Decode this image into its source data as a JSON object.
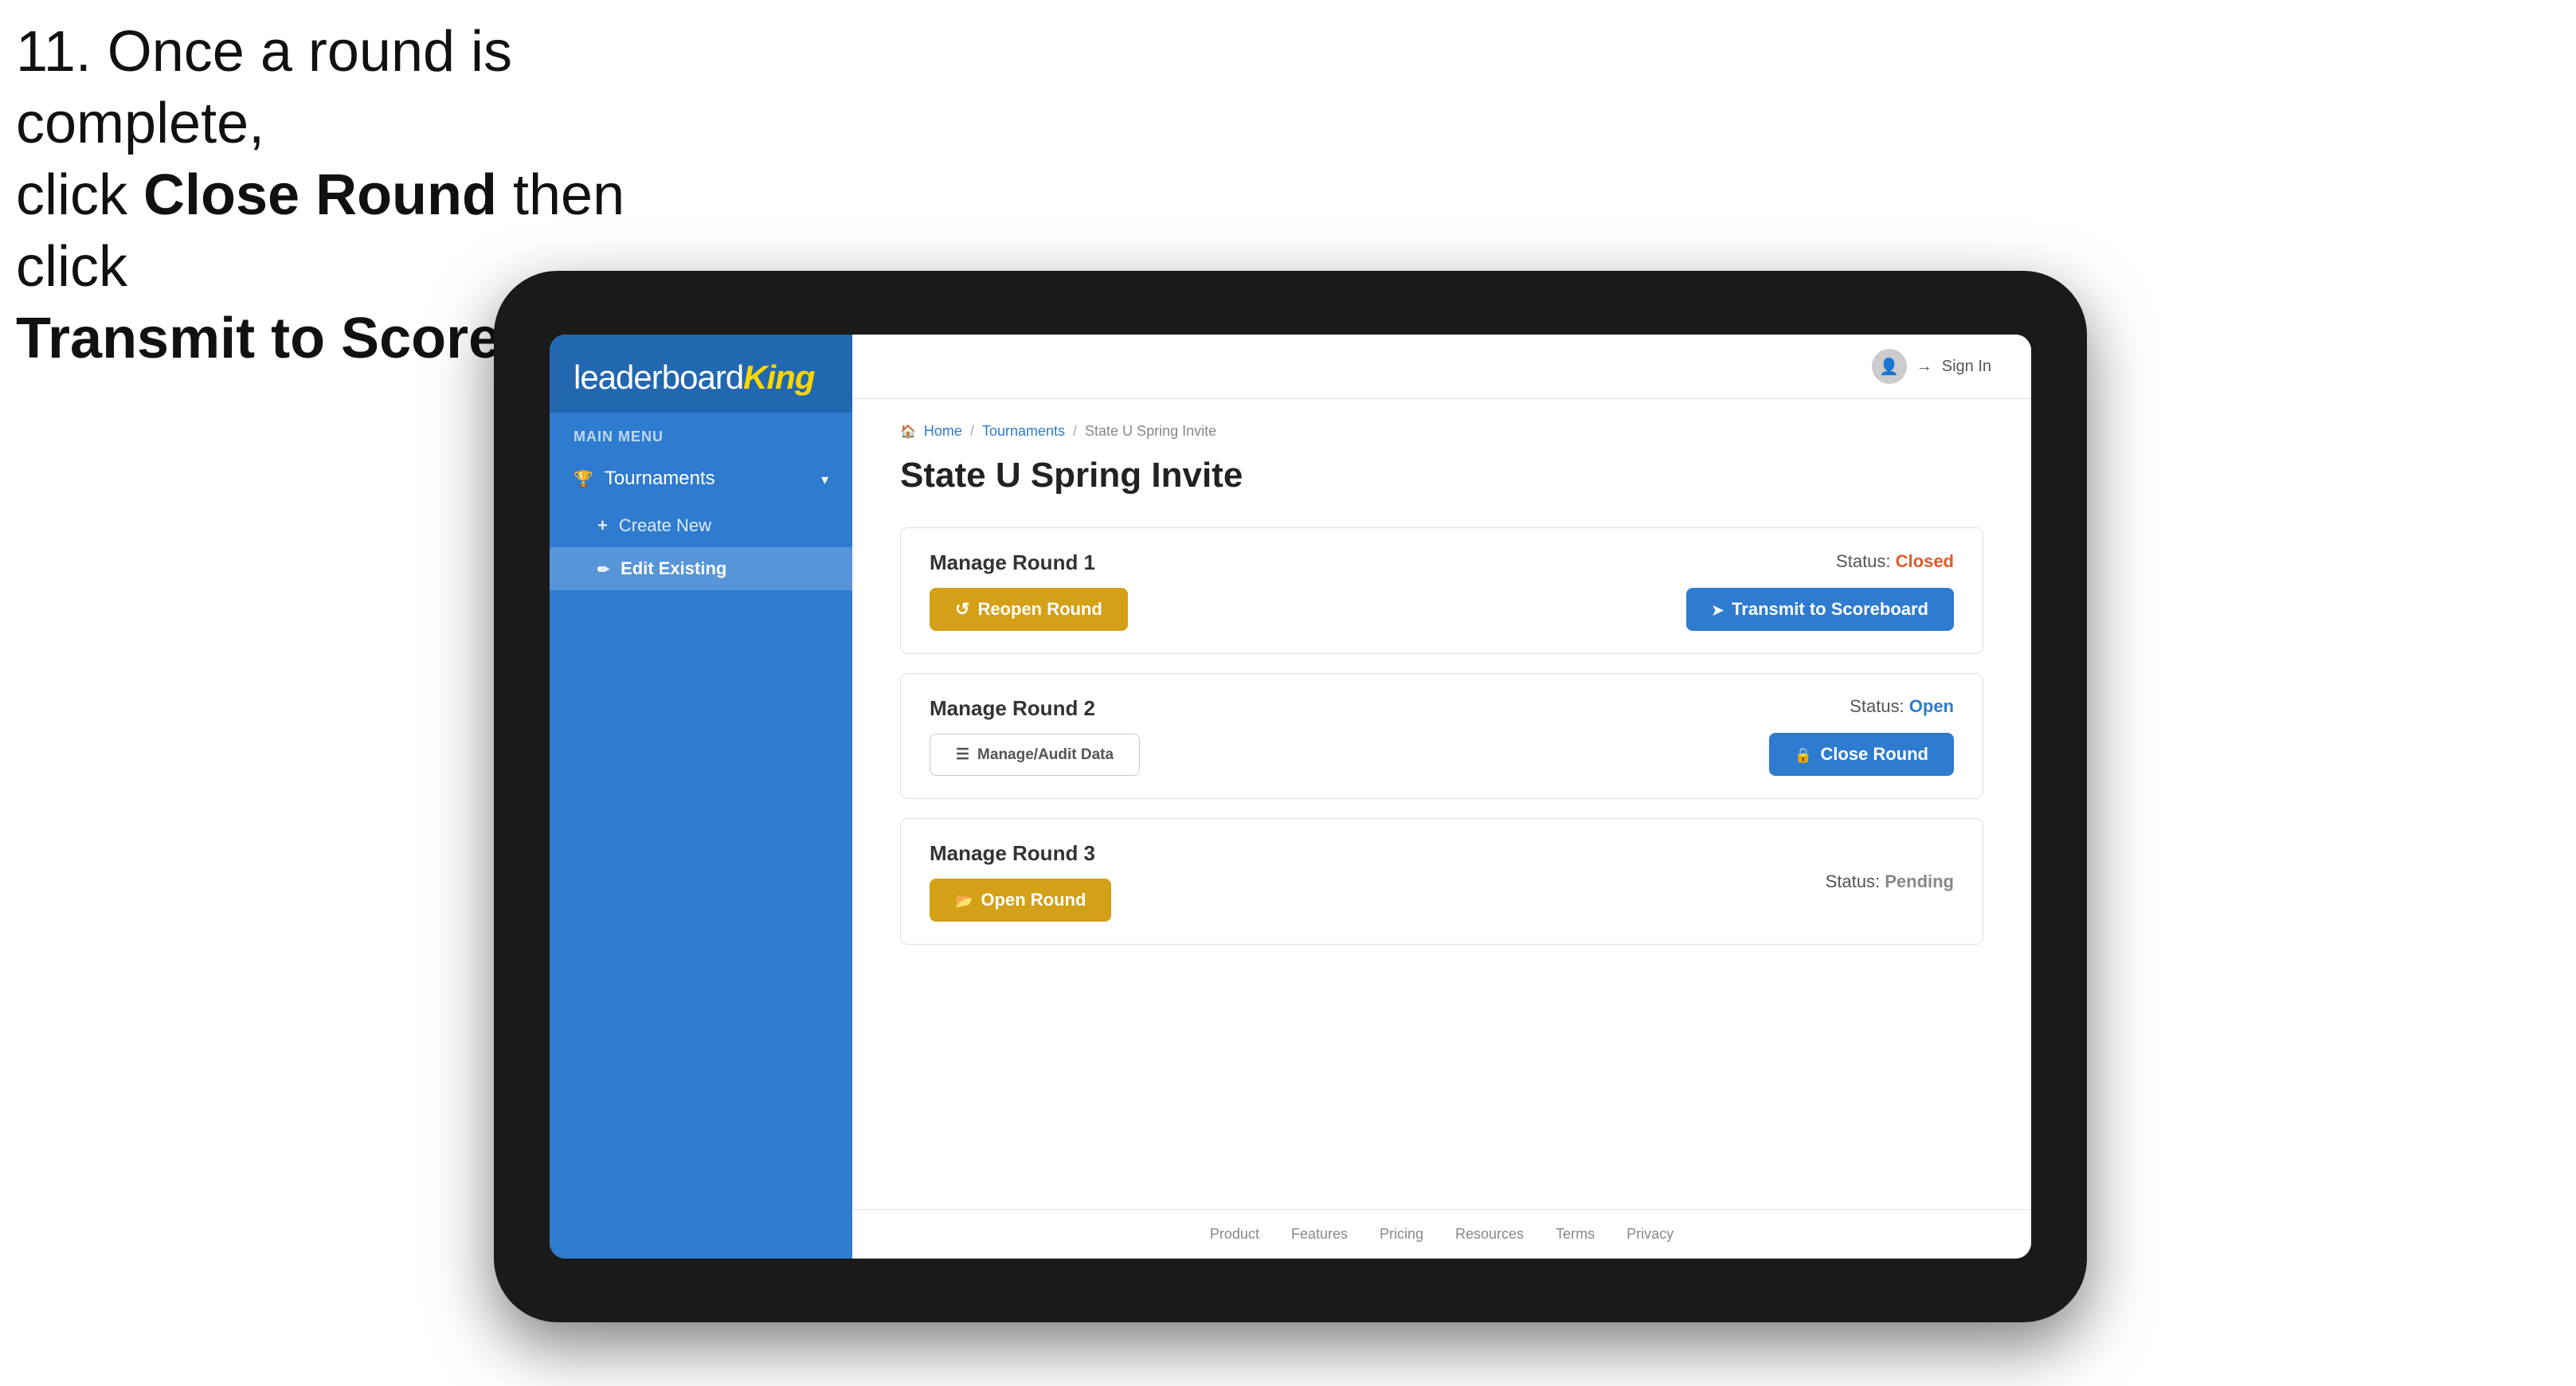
{
  "instruction": {
    "line1": "11. Once a round is complete,",
    "line2_prefix": "click ",
    "line2_bold": "Close Round",
    "line2_suffix": " then click",
    "line3_bold": "Transmit to Scoreboard."
  },
  "header": {
    "sign_in_label": "Sign In"
  },
  "breadcrumb": {
    "home": "Home",
    "sep1": "/",
    "tournaments": "Tournaments",
    "sep2": "/",
    "current": "State U Spring Invite"
  },
  "page": {
    "title": "State U Spring Invite"
  },
  "sidebar": {
    "main_menu_label": "MAIN MENU",
    "logo_leaderboard": "leaderboard",
    "logo_king": "King",
    "tournaments_label": "Tournaments",
    "create_new_label": "Create New",
    "edit_existing_label": "Edit Existing"
  },
  "rounds": [
    {
      "id": "round1",
      "title": "Manage Round 1",
      "status_label": "Status:",
      "status_value": "Closed",
      "status_class": "status-closed",
      "buttons": [
        {
          "id": "reopen",
          "label": "Reopen Round",
          "style": "btn-gold",
          "icon": "icon-refresh"
        },
        {
          "id": "transmit",
          "label": "Transmit to Scoreboard",
          "style": "btn-blue",
          "icon": "icon-send"
        }
      ]
    },
    {
      "id": "round2",
      "title": "Manage Round 2",
      "status_label": "Status:",
      "status_value": "Open",
      "status_class": "status-open",
      "buttons": [
        {
          "id": "audit",
          "label": "Manage/Audit Data",
          "style": "btn-outline",
          "icon": ""
        },
        {
          "id": "close",
          "label": "Close Round",
          "style": "btn-blue",
          "icon": "icon-lock"
        }
      ]
    },
    {
      "id": "round3",
      "title": "Manage Round 3",
      "status_label": "Status:",
      "status_value": "Pending",
      "status_class": "status-pending",
      "buttons": [
        {
          "id": "open",
          "label": "Open Round",
          "style": "btn-gold",
          "icon": "icon-open"
        }
      ]
    }
  ],
  "footer": {
    "links": [
      "Product",
      "Features",
      "Pricing",
      "Resources",
      "Terms",
      "Privacy"
    ]
  },
  "colors": {
    "sidebar_bg": "#2e7bcf",
    "btn_gold": "#d4a017",
    "btn_blue": "#2e7bcf",
    "status_closed": "#e05a2b",
    "status_open": "#2e7bcf",
    "status_pending": "#888888"
  }
}
